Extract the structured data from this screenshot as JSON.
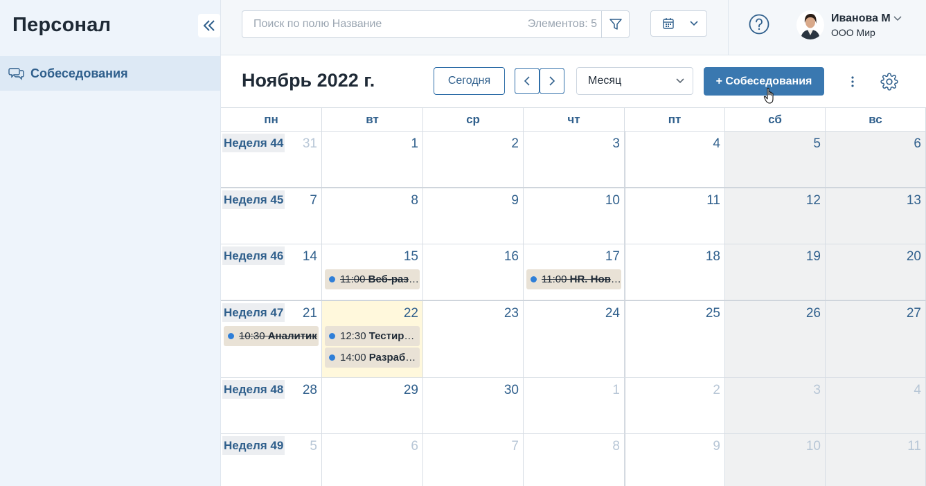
{
  "sidebar": {
    "title": "Персонал",
    "items": [
      {
        "label": "Собеседования",
        "icon": "chat-icon",
        "active": true
      }
    ]
  },
  "topbar": {
    "search_placeholder": "Поиск по полю Название",
    "search_count": "Элементов: 5",
    "user_name": "Иванова М",
    "user_org": "ООО Мир"
  },
  "toolbar": {
    "month_title": "Ноябрь 2022 г.",
    "today_label": "Сегодня",
    "period_value": "Месяц",
    "add_label": "+ Собеседования"
  },
  "calendar": {
    "days_of_week": [
      "пн",
      "вт",
      "ср",
      "чт",
      "пт",
      "сб",
      "вс"
    ],
    "weeks": [
      {
        "label": "Неделя 44",
        "days": [
          {
            "num": "31",
            "muted": true
          },
          {
            "num": "1"
          },
          {
            "num": "2"
          },
          {
            "num": "3"
          },
          {
            "num": "4"
          },
          {
            "num": "5"
          },
          {
            "num": "6"
          }
        ]
      },
      {
        "label": "Неделя 45",
        "days": [
          {
            "num": "7"
          },
          {
            "num": "8"
          },
          {
            "num": "9"
          },
          {
            "num": "10"
          },
          {
            "num": "11"
          },
          {
            "num": "12"
          },
          {
            "num": "13"
          }
        ]
      },
      {
        "label": "Неделя 46",
        "days": [
          {
            "num": "14"
          },
          {
            "num": "15",
            "events": [
              {
                "time": "11:00",
                "title": "Веб-разработчик",
                "struck": true
              }
            ]
          },
          {
            "num": "16"
          },
          {
            "num": "17",
            "events": [
              {
                "time": "11:00",
                "title": "HR. Новиков",
                "struck": true
              }
            ]
          },
          {
            "num": "18"
          },
          {
            "num": "19"
          },
          {
            "num": "20"
          }
        ]
      },
      {
        "label": "Неделя 47",
        "days": [
          {
            "num": "21",
            "events": [
              {
                "time": "10:30",
                "title": "Аналитик",
                "struck": true
              }
            ]
          },
          {
            "num": "22",
            "today": true,
            "events": [
              {
                "time": "12:30",
                "title": "Тестировщик",
                "struck": false
              },
              {
                "time": "14:00",
                "title": "Разработчик",
                "struck": false
              }
            ]
          },
          {
            "num": "23"
          },
          {
            "num": "24"
          },
          {
            "num": "25"
          },
          {
            "num": "26"
          },
          {
            "num": "27"
          }
        ]
      },
      {
        "label": "Неделя 48",
        "days": [
          {
            "num": "28"
          },
          {
            "num": "29"
          },
          {
            "num": "30"
          },
          {
            "num": "1",
            "muted": true
          },
          {
            "num": "2",
            "muted": true
          },
          {
            "num": "3",
            "muted": true
          },
          {
            "num": "4",
            "muted": true
          }
        ]
      },
      {
        "label": "Неделя 49",
        "days": [
          {
            "num": "5",
            "muted": true
          },
          {
            "num": "6",
            "muted": true
          },
          {
            "num": "7",
            "muted": true
          },
          {
            "num": "8",
            "muted": true
          },
          {
            "num": "9",
            "muted": true
          },
          {
            "num": "10",
            "muted": true
          },
          {
            "num": "11",
            "muted": true
          }
        ]
      }
    ]
  },
  "colors": {
    "accent": "#3a78b0",
    "link": "#2f5f8c",
    "today_bg": "#fff8dc",
    "weekend_bg": "#f0f1f2",
    "event_bg": "#e9e2d6",
    "event_dot": "#2f7fd8"
  }
}
